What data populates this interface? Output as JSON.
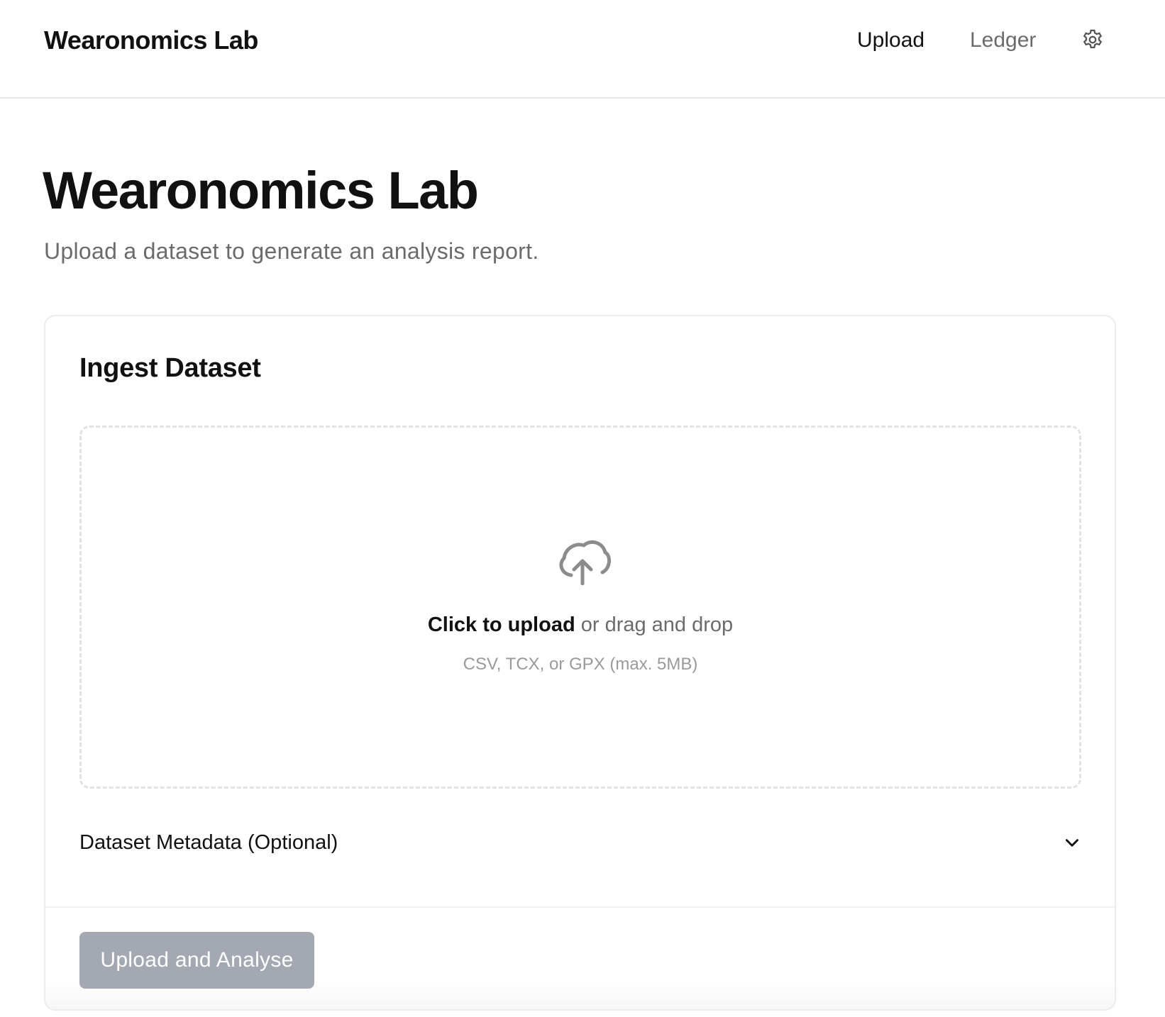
{
  "header": {
    "brand": "Wearonomics Lab",
    "nav": {
      "upload_label": "Upload",
      "ledger_label": "Ledger"
    },
    "settings_icon": "gear-icon"
  },
  "page": {
    "title": "Wearonomics Lab",
    "subtitle": "Upload a dataset to generate an analysis report."
  },
  "card": {
    "title": "Ingest Dataset",
    "dropzone": {
      "icon": "cloud-upload-icon",
      "cta_strong": "Click to upload",
      "cta_rest": " or drag and drop",
      "hint": "CSV, TCX, or GPX (max. 5MB)"
    },
    "metadata": {
      "label": "Dataset Metadata (Optional)",
      "icon": "chevron-down-icon",
      "expanded": false
    },
    "submit_label": "Upload and Analyse",
    "submit_disabled": true
  },
  "colors": {
    "text_primary": "#111111",
    "text_muted": "#6b6b6b",
    "text_faint": "#9a9a9a",
    "button_disabled_bg": "#a3a8b2",
    "border": "#e5e7eb"
  }
}
